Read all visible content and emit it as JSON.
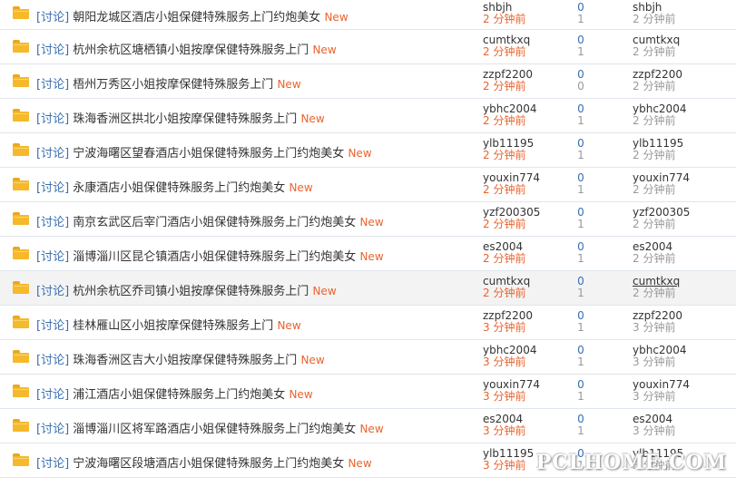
{
  "tag": "[讨论]",
  "new_label": "New",
  "watermark": "PCLHOME.COM",
  "colors": {
    "tag": "#3a6fb0",
    "new": "#e9632d",
    "time_red": "#e9632d",
    "count_blue": "#3a6fb0",
    "count_gray": "#999999",
    "folder": "#f6b92b"
  },
  "icons": {
    "thread": "folder-icon"
  },
  "threads": [
    {
      "title": "朝阳龙城区酒店小姐保健特殊服务上门约炮美女",
      "author": "shbjh",
      "author_time": "2 分钟前",
      "replies": "0",
      "views": "1",
      "last_user": "shbjh",
      "last_time": "2 分钟前"
    },
    {
      "title": "杭州余杭区塘栖镇小姐按摩保健特殊服务上门",
      "author": "cumtkxq",
      "author_time": "2 分钟前",
      "replies": "0",
      "views": "1",
      "last_user": "cumtkxq",
      "last_time": "2 分钟前"
    },
    {
      "title": "梧州万秀区小姐按摩保健特殊服务上门",
      "author": "zzpf2200",
      "author_time": "2 分钟前",
      "replies": "0",
      "views": "0",
      "last_user": "zzpf2200",
      "last_time": "2 分钟前"
    },
    {
      "title": "珠海香洲区拱北小姐按摩保健特殊服务上门",
      "author": "ybhc2004",
      "author_time": "2 分钟前",
      "replies": "0",
      "views": "1",
      "last_user": "ybhc2004",
      "last_time": "2 分钟前"
    },
    {
      "title": "宁波海曙区望春酒店小姐保健特殊服务上门约炮美女",
      "author": "ylb11195",
      "author_time": "2 分钟前",
      "replies": "0",
      "views": "1",
      "last_user": "ylb11195",
      "last_time": "2 分钟前"
    },
    {
      "title": "永康酒店小姐保健特殊服务上门约炮美女",
      "author": "youxin774",
      "author_time": "2 分钟前",
      "replies": "0",
      "views": "1",
      "last_user": "youxin774",
      "last_time": "2 分钟前"
    },
    {
      "title": "南京玄武区后宰门酒店小姐保健特殊服务上门约炮美女",
      "author": "yzf200305",
      "author_time": "2 分钟前",
      "replies": "0",
      "views": "1",
      "last_user": "yzf200305",
      "last_time": "2 分钟前"
    },
    {
      "title": "淄博淄川区昆仑镇酒店小姐保健特殊服务上门约炮美女",
      "author": "es2004",
      "author_time": "2 分钟前",
      "replies": "0",
      "views": "1",
      "last_user": "es2004",
      "last_time": "2 分钟前"
    },
    {
      "title": "杭州余杭区乔司镇小姐按摩保健特殊服务上门",
      "author": "cumtkxq",
      "author_time": "2 分钟前",
      "replies": "0",
      "views": "1",
      "last_user": "cumtkxq",
      "last_time": "2 分钟前"
    },
    {
      "title": "桂林雁山区小姐按摩保健特殊服务上门",
      "author": "zzpf2200",
      "author_time": "3 分钟前",
      "replies": "0",
      "views": "1",
      "last_user": "zzpf2200",
      "last_time": "3 分钟前"
    },
    {
      "title": "珠海香洲区吉大小姐按摩保健特殊服务上门",
      "author": "ybhc2004",
      "author_time": "3 分钟前",
      "replies": "0",
      "views": "1",
      "last_user": "ybhc2004",
      "last_time": "3 分钟前"
    },
    {
      "title": "浦江酒店小姐保健特殊服务上门约炮美女",
      "author": "youxin774",
      "author_time": "3 分钟前",
      "replies": "0",
      "views": "1",
      "last_user": "youxin774",
      "last_time": "3 分钟前"
    },
    {
      "title": "淄博淄川区将军路酒店小姐保健特殊服务上门约炮美女",
      "author": "es2004",
      "author_time": "3 分钟前",
      "replies": "0",
      "views": "1",
      "last_user": "es2004",
      "last_time": "3 分钟前"
    },
    {
      "title": "宁波海曙区段塘酒店小姐保健特殊服务上门约炮美女",
      "author": "ylb11195",
      "author_time": "3 分钟前",
      "replies": "0",
      "views": "1",
      "last_user": "ylb11195",
      "last_time": "3 分钟前"
    }
  ]
}
